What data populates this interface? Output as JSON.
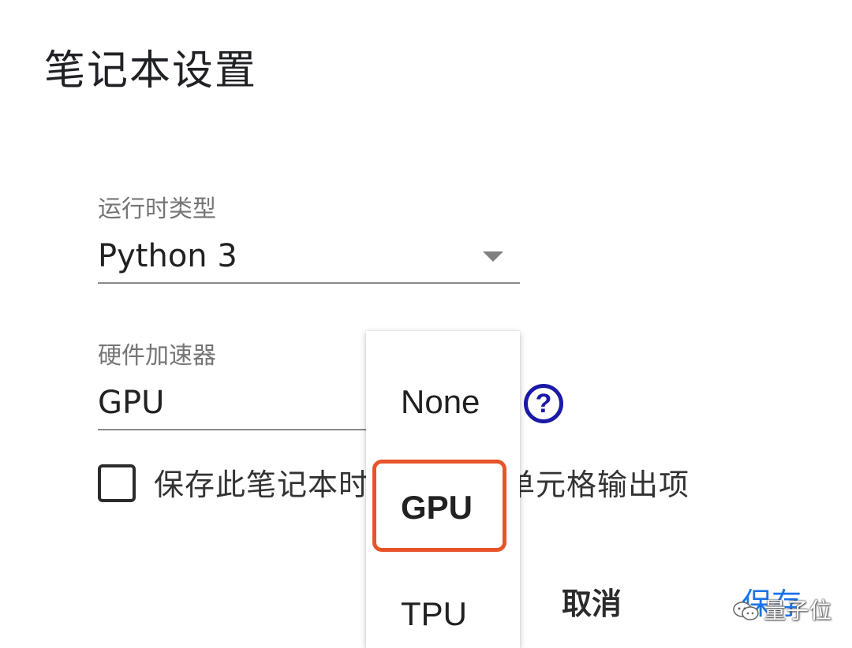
{
  "dialog": {
    "title": "笔记本设置"
  },
  "runtime_type": {
    "label": "运行时类型",
    "value": "Python 3"
  },
  "hardware_accelerator": {
    "label": "硬件加速器",
    "value": "GPU",
    "options": [
      "None",
      "GPU",
      "TPU"
    ],
    "selected": "GPU"
  },
  "omit_output": {
    "label": "保存此笔记本时忽略代码单元格输出项",
    "visible_label_left": "保存此笔记本时",
    "visible_label_right": "单元格输出项",
    "checked": false
  },
  "actions": {
    "cancel_label": "取消",
    "save_label": "保存"
  },
  "watermark": {
    "text": "量子位"
  },
  "colors": {
    "highlight": "#e8542a",
    "help_icon": "#1a1aa6",
    "save_button": "#1a73e8"
  }
}
